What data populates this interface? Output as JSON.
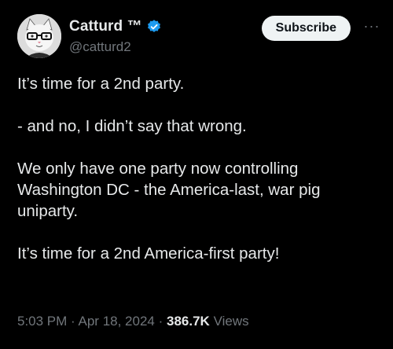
{
  "author": {
    "display_name": "Catturd ™",
    "handle": "@catturd2",
    "verified_color": "#1d9bf0"
  },
  "actions": {
    "subscribe_label": "Subscribe",
    "more_icon": "more-horizontal-icon"
  },
  "tweet": {
    "paragraphs": [
      "It’s time for a 2nd party.",
      "- and no, I didn’t say that wrong.",
      "We only have one party now controlling Washington DC - the America-last, war pig uniparty.",
      "It’s time for a 2nd America-first party!"
    ]
  },
  "meta": {
    "time": "5:03 PM",
    "separator": "·",
    "date": "Apr 18, 2024",
    "views_count": "386.7K",
    "views_label": "Views"
  }
}
